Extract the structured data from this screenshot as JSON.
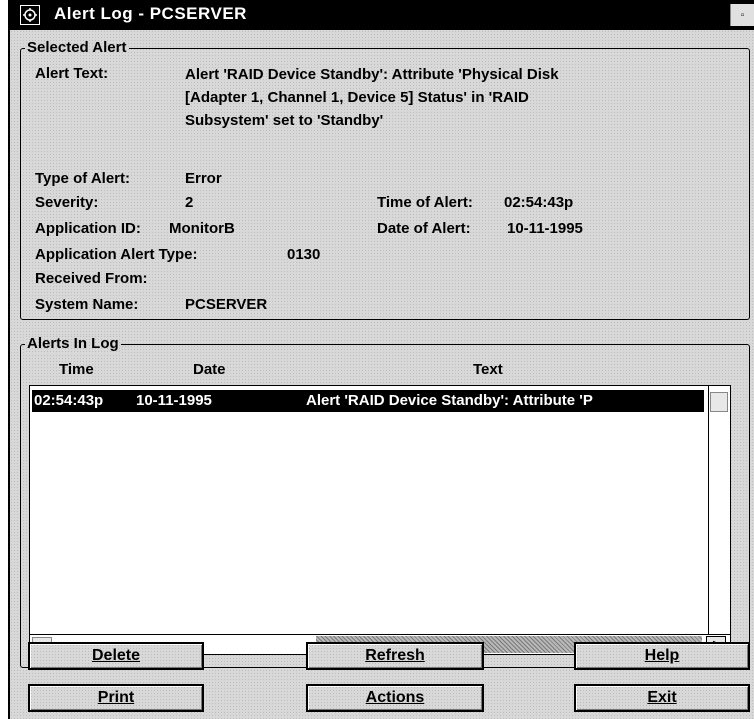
{
  "window": {
    "title": "Alert Log - PCSERVER",
    "title_button_glyph": "▫"
  },
  "selected_alert": {
    "legend": "Selected Alert",
    "alert_text_label": "Alert Text:",
    "alert_text_lines": [
      "Alert 'RAID Device Standby': Attribute 'Physical Disk",
      "[Adapter 1, Channel 1, Device 5] Status' in 'RAID",
      "Subsystem' set to 'Standby'"
    ],
    "type_label": "Type of Alert:",
    "type_value": "Error",
    "severity_label": "Severity:",
    "severity_value": "2",
    "time_label": "Time of Alert:",
    "time_value": "02:54:43p",
    "app_id_label": "Application ID:",
    "app_id_value": "MonitorB",
    "date_label": "Date of Alert:",
    "date_value": "10-11-1995",
    "app_type_label": "Application Alert Type:",
    "app_type_value": "0130",
    "received_label": "Received From:",
    "received_value": "",
    "system_label": "System Name:",
    "system_value": "PCSERVER"
  },
  "alerts_in_log": {
    "legend": "Alerts In Log",
    "columns": [
      "Time",
      "Date",
      "Text"
    ],
    "rows": [
      {
        "time": "02:54:43p",
        "date": "10-11-1995",
        "text": "Alert 'RAID Device Standby': Attribute 'P"
      }
    ],
    "scroll_right_glyph": ">"
  },
  "buttons": {
    "delete": "Delete",
    "refresh": "Refresh",
    "help": "Help",
    "print": "Print",
    "actions": "Actions",
    "exit": "Exit"
  },
  "icons": {
    "system_menu": "system-menu-icon",
    "scroll_right": "scroll-right-arrow-icon"
  },
  "colors": {
    "titlebar": "#000000",
    "selection": "#000000",
    "face": "#d8d8d8"
  }
}
